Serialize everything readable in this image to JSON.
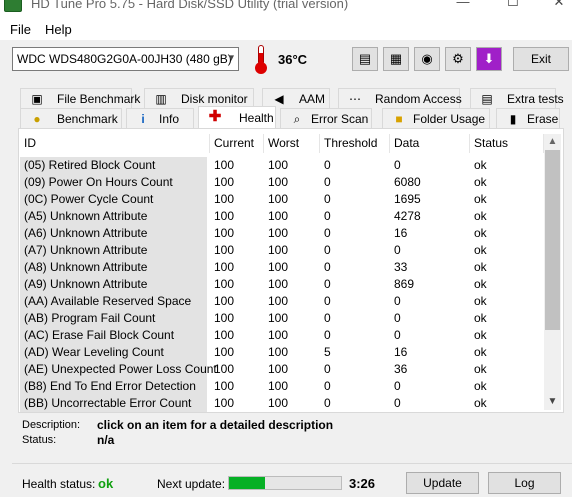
{
  "window": {
    "title": "HD Tune Pro 5.75 - Hard Disk/SSD Utility (trial version)",
    "minimize": "—",
    "maximize": "☐",
    "close": "✕"
  },
  "menu": {
    "file": "File",
    "help": "Help"
  },
  "toolbar": {
    "drive": "WDC WDS480G2G0A-00JH30 (480 gB)",
    "temperature": "36°C",
    "exit_label": "Exit"
  },
  "tabs_top": [
    {
      "label": "File Benchmark",
      "icon": "file-benchmark-icon"
    },
    {
      "label": "Disk monitor",
      "icon": "disk-monitor-icon"
    },
    {
      "label": "AAM",
      "icon": "speaker-icon"
    },
    {
      "label": "Random Access",
      "icon": "random-access-icon"
    },
    {
      "label": "Extra tests",
      "icon": "extra-tests-icon"
    }
  ],
  "tabs_bottom": [
    {
      "label": "Benchmark",
      "icon": "bulb-icon"
    },
    {
      "label": "Info",
      "icon": "info-icon"
    },
    {
      "label": "Health",
      "icon": "health-cross-icon"
    },
    {
      "label": "Error Scan",
      "icon": "magnifier-icon"
    },
    {
      "label": "Folder Usage",
      "icon": "folder-icon"
    },
    {
      "label": "Erase",
      "icon": "trash-icon"
    }
  ],
  "table": {
    "columns": [
      "ID",
      "Current",
      "Worst",
      "Threshold",
      "Data",
      "Status"
    ],
    "rows": [
      [
        "(05) Retired Block Count",
        "100",
        "100",
        "0",
        "0",
        "ok"
      ],
      [
        "(09) Power On Hours Count",
        "100",
        "100",
        "0",
        "6080",
        "ok"
      ],
      [
        "(0C) Power Cycle Count",
        "100",
        "100",
        "0",
        "1695",
        "ok"
      ],
      [
        "(A5) Unknown Attribute",
        "100",
        "100",
        "0",
        "4278",
        "ok"
      ],
      [
        "(A6) Unknown Attribute",
        "100",
        "100",
        "0",
        "16",
        "ok"
      ],
      [
        "(A7) Unknown Attribute",
        "100",
        "100",
        "0",
        "0",
        "ok"
      ],
      [
        "(A8) Unknown Attribute",
        "100",
        "100",
        "0",
        "33",
        "ok"
      ],
      [
        "(A9) Unknown Attribute",
        "100",
        "100",
        "0",
        "869",
        "ok"
      ],
      [
        "(AA) Available Reserved Space",
        "100",
        "100",
        "0",
        "0",
        "ok"
      ],
      [
        "(AB) Program Fail Count",
        "100",
        "100",
        "0",
        "0",
        "ok"
      ],
      [
        "(AC) Erase Fail Block Count",
        "100",
        "100",
        "0",
        "0",
        "ok"
      ],
      [
        "(AD) Wear Leveling Count",
        "100",
        "100",
        "5",
        "16",
        "ok"
      ],
      [
        "(AE) Unexpected Power Loss Count",
        "100",
        "100",
        "0",
        "36",
        "ok"
      ],
      [
        "(B8) End To End Error Detection",
        "100",
        "100",
        "0",
        "0",
        "ok"
      ],
      [
        "(BB) Uncorrectable Error Count",
        "100",
        "100",
        "0",
        "0",
        "ok"
      ]
    ]
  },
  "details": {
    "description_label": "Description:",
    "description_value": "click on an item for a detailed description",
    "status_label": "Status:",
    "status_value": "n/a"
  },
  "statusbar": {
    "health_label": "Health status:",
    "health_value": "ok",
    "health_color": "#10a010",
    "next_update_label": "Next update:",
    "progress_fraction": 0.32,
    "countdown": "3:26",
    "update_label": "Update",
    "log_label": "Log"
  }
}
